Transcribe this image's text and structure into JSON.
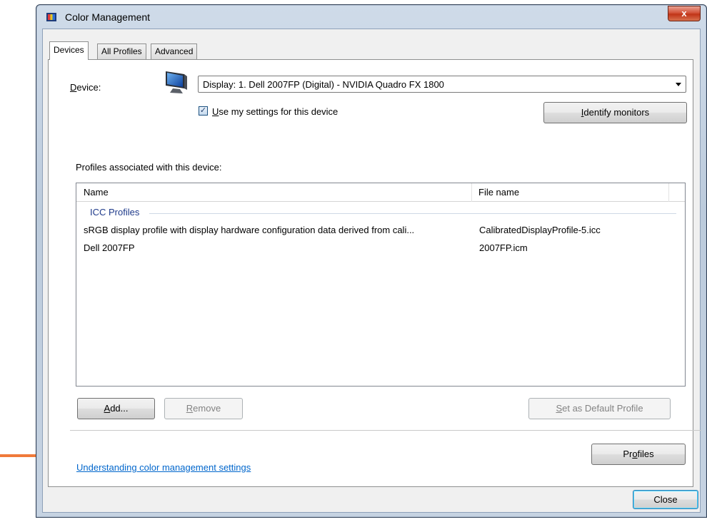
{
  "window": {
    "title": "Color Management",
    "close_glyph": "x"
  },
  "tabs": [
    {
      "label": "Devices",
      "active": true
    },
    {
      "label": "All Profiles",
      "active": false
    },
    {
      "label": "Advanced",
      "active": false
    }
  ],
  "device": {
    "label_mnemonic": "D",
    "label_rest": "evice:",
    "selected": "Display: 1. Dell 2007FP (Digital) - NVIDIA Quadro FX 1800",
    "icon": "monitor-icon"
  },
  "use_settings": {
    "checked": true,
    "check_glyph": "✓",
    "label_mnemonic": "U",
    "label_rest": "se my settings for this device"
  },
  "identify_button": {
    "mnemonic": "I",
    "rest": "dentify monitors"
  },
  "profiles_heading": "Profiles associated with this device:",
  "profiles_table": {
    "columns": [
      "Name",
      "File name"
    ],
    "group": "ICC Profiles",
    "rows": [
      {
        "name": "sRGB display profile with display hardware configuration data derived from cali...",
        "file": "CalibratedDisplayProfile-5.icc"
      },
      {
        "name": "Dell 2007FP",
        "file": "2007FP.icm"
      }
    ]
  },
  "buttons": {
    "add": {
      "mnemonic": "A",
      "rest": "dd..."
    },
    "remove": {
      "mnemonic": "R",
      "rest": "emove"
    },
    "set_default": {
      "mnemonic": "S",
      "rest": "et as Default Profile"
    },
    "profiles": {
      "pre": "Pr",
      "mnemonic": "o",
      "rest": "files"
    },
    "close": "Close"
  },
  "help_link": "Understanding color management settings",
  "colors": {
    "accent_link": "#0066cc",
    "annotation_arrow": "#f07a3a",
    "close_button": "#c7452b"
  }
}
